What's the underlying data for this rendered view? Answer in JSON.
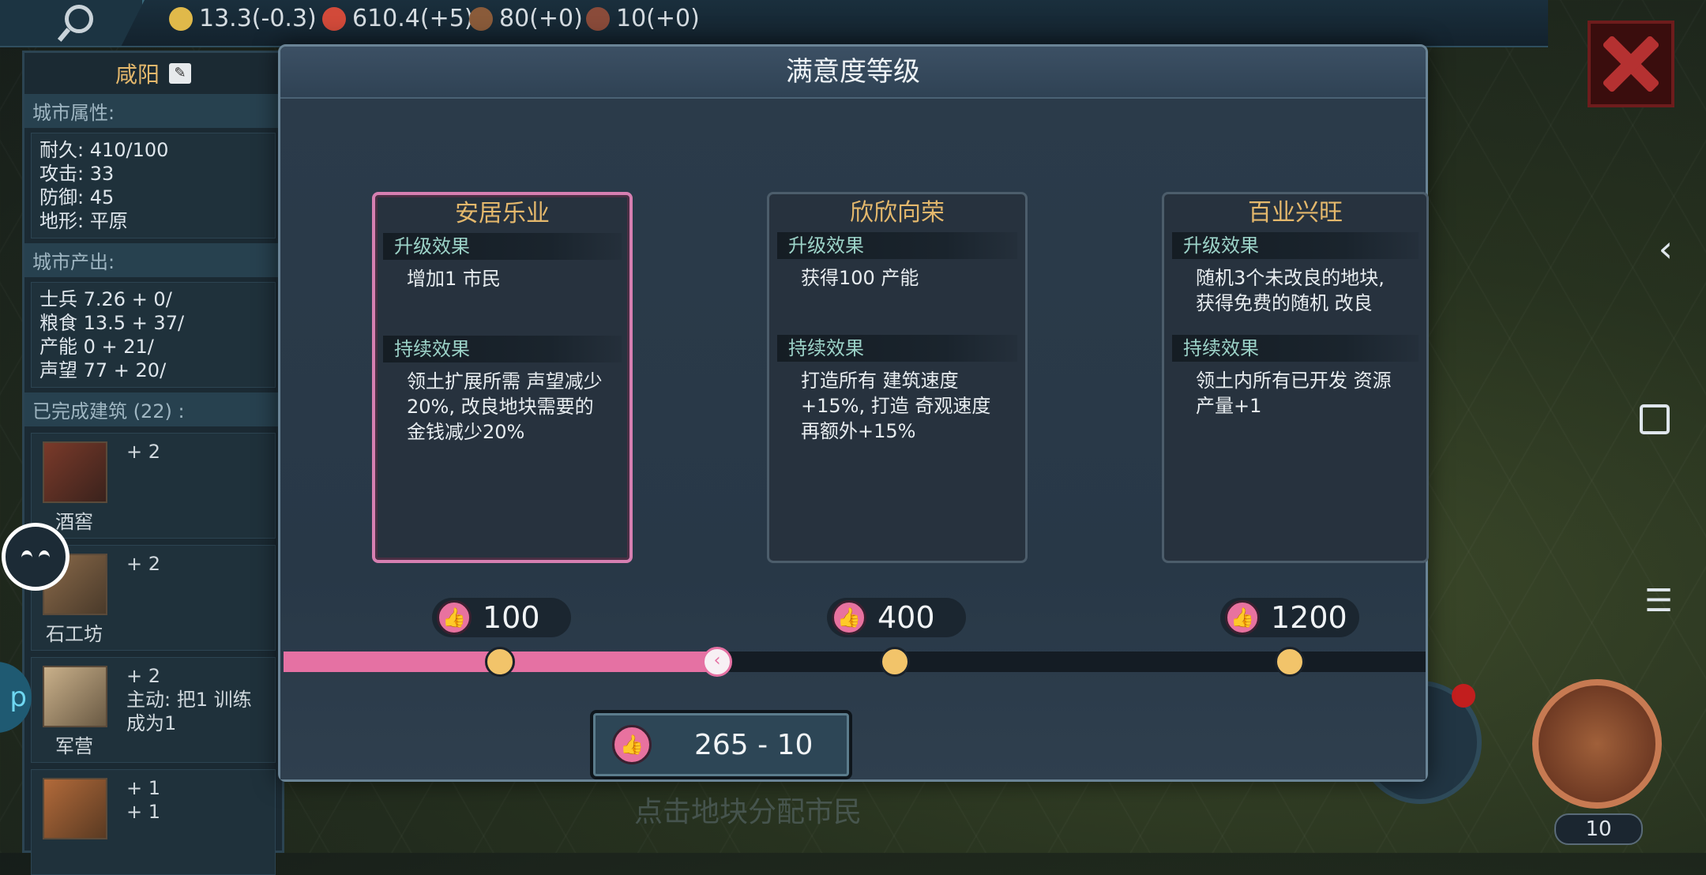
{
  "resources": [
    {
      "icon": "gold-coin-icon",
      "value": "13.3(-0.3)",
      "color": "#e0b94a"
    },
    {
      "icon": "soldier-helmet-icon",
      "value": "610.4(+5)",
      "color": "#d24a3a"
    },
    {
      "icon": "horse-icon",
      "value": "80(+0)",
      "color": "#8a5b3a"
    },
    {
      "icon": "ore-icon",
      "value": "10(+0)",
      "color": "#8a4b3a"
    }
  ],
  "city": {
    "name": "咸阳",
    "attr_header": "城市属性:",
    "attrs": [
      "耐久: 410/100",
      "攻击: 33",
      "防御: 45",
      "地形: 平原"
    ],
    "output_header": "城市产出:",
    "outputs": [
      "士兵 7.26 + 0/",
      "粮食 13.5 + 37/",
      "产能 0 + 21/",
      "声望 77 + 20/"
    ],
    "buildings_header": "已完成建筑 (22) :",
    "buildings": [
      {
        "name": "酒窖",
        "effect1": "+ 2",
        "effect2": ""
      },
      {
        "name": "石工坊",
        "effect1": "+ 2",
        "effect2": ""
      },
      {
        "name": "军营",
        "effect1": "+ 2",
        "effect2": "主动: 把1 训练",
        "effect3": "成为1"
      },
      {
        "name": "",
        "effect1": "+ 1",
        "effect2": "+ 1"
      }
    ]
  },
  "modal": {
    "title": "满意度等级",
    "upgrade_label": "升级效果",
    "persist_label": "持续效果",
    "cards": [
      {
        "title": "安居乐业",
        "upgrade": "增加1 市民",
        "persist": "领土扩展所需 声望减少20%, 改良地块需要的 金钱减少20%",
        "threshold": "100"
      },
      {
        "title": "欣欣向荣",
        "upgrade": "获得100 产能",
        "persist": "打造所有 建筑速度+15%, 打造 奇观速度再额外+15%",
        "threshold": "400"
      },
      {
        "title": "百业兴旺",
        "upgrade": "随机3个未改良的地块, 获得免费的随机 改良",
        "persist": "领土内所有已开发 资源产量+1",
        "threshold": "1200"
      }
    ],
    "progress_fraction": 0.38,
    "current": "265 - 10",
    "hint": "点击地块分配市民"
  },
  "bottom_right_count": "10"
}
